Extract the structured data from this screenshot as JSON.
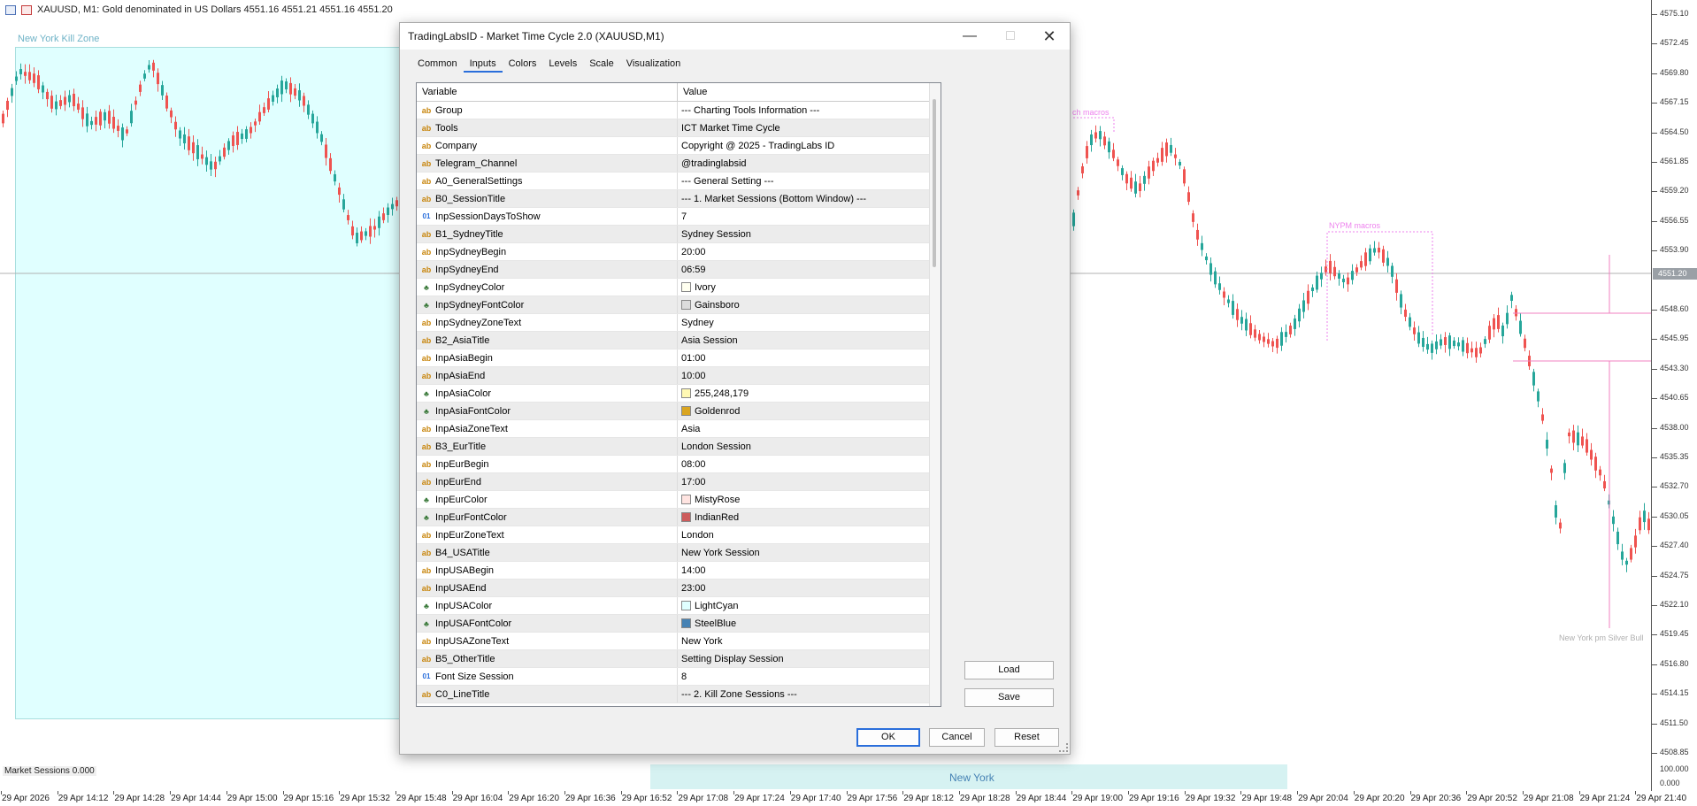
{
  "header": {
    "symbol_text": "XAUUSD, M1:  Gold denominated in US Dollars  4551.16 4551.21 4551.16 4551.20"
  },
  "chart": {
    "ny_killzone_label": "New York Kill Zone",
    "annotations": {
      "london_macros": "ch macros",
      "nypm_macros": "NYPM macros",
      "silver_bullet": "New York pm  Silver Bull"
    },
    "price_labels": [
      "4575.10",
      "4572.45",
      "4569.80",
      "4567.15",
      "4564.50",
      "4561.85",
      "4559.20",
      "4556.55",
      "4553.90",
      "4548.60",
      "4545.95",
      "4543.30",
      "4540.65",
      "4538.00",
      "4535.35",
      "4532.70",
      "4530.05",
      "4527.40",
      "4524.75",
      "4522.10",
      "4519.45",
      "4516.80",
      "4514.15",
      "4511.50",
      "4508.85"
    ],
    "current_price": "4551.20",
    "time_labels": [
      "29 Apr 2026",
      "29 Apr 14:12",
      "29 Apr 14:28",
      "29 Apr 14:44",
      "29 Apr 15:00",
      "29 Apr 15:16",
      "29 Apr 15:32",
      "29 Apr 15:48",
      "29 Apr 16:04",
      "29 Apr 16:20",
      "29 Apr 16:36",
      "29 Apr 16:52",
      "29 Apr 17:08",
      "29 Apr 17:24",
      "29 Apr 17:40",
      "29 Apr 17:56",
      "29 Apr 18:12",
      "29 Apr 18:28",
      "29 Apr 18:44",
      "29 Apr 19:00",
      "29 Apr 19:16",
      "29 Apr 19:32",
      "29 Apr 19:48",
      "29 Apr 20:04",
      "29 Apr 20:20",
      "29 Apr 20:36",
      "29 Apr 20:52",
      "29 Apr 21:08",
      "29 Apr 21:24",
      "29 Apr 21:40"
    ],
    "colors": {
      "bull": "#26a69a",
      "bear": "#ef5350",
      "killzone": "#e0ffff",
      "macros": "#ee82ee"
    }
  },
  "subwindow": {
    "label": "Market Sessions 0.000",
    "session_label": "New York",
    "scale_top": "100.000",
    "scale_bottom": "0.000"
  },
  "dialog": {
    "title": "TradingLabsID - Market Time Cycle 2.0 (XAUUSD,M1)",
    "tabs": [
      "Common",
      "Inputs",
      "Colors",
      "Levels",
      "Scale",
      "Visualization"
    ],
    "active_tab": "Inputs",
    "grid": {
      "col_variable": "Variable",
      "col_value": "Value",
      "rows": [
        {
          "type": "ab",
          "name": "Group",
          "value": "--- Charting Tools Information ---"
        },
        {
          "type": "ab",
          "name": "Tools",
          "value": "ICT Market Time Cycle"
        },
        {
          "type": "ab",
          "name": "Company",
          "value": "Copyright @ 2025 - TradingLabs ID"
        },
        {
          "type": "ab",
          "name": "Telegram_Channel",
          "value": "@tradinglabsid"
        },
        {
          "type": "ab",
          "name": "A0_GeneralSettings",
          "value": "--- General Setting ---"
        },
        {
          "type": "ab",
          "name": "B0_SessionTitle",
          "value": "--- 1. Market Sessions (Bottom Window) ---"
        },
        {
          "type": "num",
          "name": "InpSessionDaysToShow",
          "value": "7"
        },
        {
          "type": "ab",
          "name": "B1_SydneyTitle",
          "value": "Sydney Session"
        },
        {
          "type": "ab",
          "name": "InpSydneyBegin",
          "value": "20:00"
        },
        {
          "type": "ab",
          "name": "InpSydneyEnd",
          "value": "06:59"
        },
        {
          "type": "col",
          "name": "InpSydneyColor",
          "value": "Ivory",
          "swatch": "#fffff0"
        },
        {
          "type": "col",
          "name": "InpSydneyFontColor",
          "value": "Gainsboro",
          "swatch": "#dcdcdc"
        },
        {
          "type": "ab",
          "name": "InpSydneyZoneText",
          "value": "Sydney"
        },
        {
          "type": "ab",
          "name": "B2_AsiaTitle",
          "value": "Asia Session"
        },
        {
          "type": "ab",
          "name": "InpAsiaBegin",
          "value": "01:00"
        },
        {
          "type": "ab",
          "name": "InpAsiaEnd",
          "value": "10:00"
        },
        {
          "type": "col",
          "name": "InpAsiaColor",
          "value": "255,248,179",
          "swatch": "#fff8b3"
        },
        {
          "type": "col",
          "name": "InpAsiaFontColor",
          "value": "Goldenrod",
          "swatch": "#daa520"
        },
        {
          "type": "ab",
          "name": "InpAsiaZoneText",
          "value": "Asia"
        },
        {
          "type": "ab",
          "name": "B3_EurTitle",
          "value": "London Session"
        },
        {
          "type": "ab",
          "name": "InpEurBegin",
          "value": "08:00"
        },
        {
          "type": "ab",
          "name": "InpEurEnd",
          "value": "17:00"
        },
        {
          "type": "col",
          "name": "InpEurColor",
          "value": "MistyRose",
          "swatch": "#ffe4e1"
        },
        {
          "type": "col",
          "name": "InpEurFontColor",
          "value": "IndianRed",
          "swatch": "#cd5c5c"
        },
        {
          "type": "ab",
          "name": "InpEurZoneText",
          "value": "London"
        },
        {
          "type": "ab",
          "name": "B4_USATitle",
          "value": "New York Session"
        },
        {
          "type": "ab",
          "name": "InpUSABegin",
          "value": "14:00"
        },
        {
          "type": "ab",
          "name": "InpUSAEnd",
          "value": "23:00"
        },
        {
          "type": "col",
          "name": "InpUSAColor",
          "value": "LightCyan",
          "swatch": "#e0ffff"
        },
        {
          "type": "col",
          "name": "InpUSAFontColor",
          "value": "SteelBlue",
          "swatch": "#4682b4"
        },
        {
          "type": "ab",
          "name": "InpUSAZoneText",
          "value": "New York"
        },
        {
          "type": "ab",
          "name": "B5_OtherTitle",
          "value": "Setting Display Session"
        },
        {
          "type": "num",
          "name": "Font Size Session",
          "value": "8"
        },
        {
          "type": "ab",
          "name": "C0_LineTitle",
          "value": "--- 2. Kill Zone Sessions  ---"
        }
      ]
    },
    "load_label": "Load",
    "save_label": "Save",
    "ok_label": "OK",
    "cancel_label": "Cancel",
    "reset_label": "Reset",
    "type_icons": {
      "ab": "ab",
      "num": "01",
      "col": "&"
    }
  }
}
